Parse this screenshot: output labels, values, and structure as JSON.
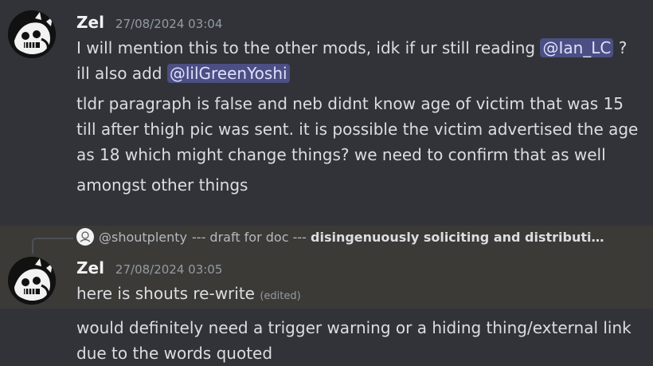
{
  "messages": [
    {
      "author": "Zel",
      "timestamp": "27/08/2024 03:04",
      "line1_pre": "I will mention this to the other mods, idk if ur still reading",
      "mention1": "@Ian_LC",
      "line1_post": "?",
      "line2_pre": "ill also add",
      "mention2": "@lilGreenYoshi",
      "para2": "tldr paragraph is false and neb didnt know age of victim that was 15 till after thigh pic was sent. it is possible the victim advertised the age as 18 which might change things? we need to confirm that as well",
      "para3": "amongst other things"
    },
    {
      "author": "Zel",
      "timestamp": "27/08/2024 03:05",
      "reply": {
        "author": "@shoutplenty",
        "preview_plain": "--- draft for doc ---",
        "preview_bold": "disingenuously soliciting and distributi…"
      },
      "line1": "here is shouts re-write",
      "edited_label": "(edited)",
      "para2": "would definitely need a trigger warning or a hiding thing/external link due to the words quoted"
    }
  ],
  "colors": {
    "background": "#313338",
    "highlight": "#3b3a36",
    "mention_bg": "#4b4f83",
    "mention_text": "#dee0fc",
    "text": "#dbdee1",
    "muted": "#949ba4"
  }
}
